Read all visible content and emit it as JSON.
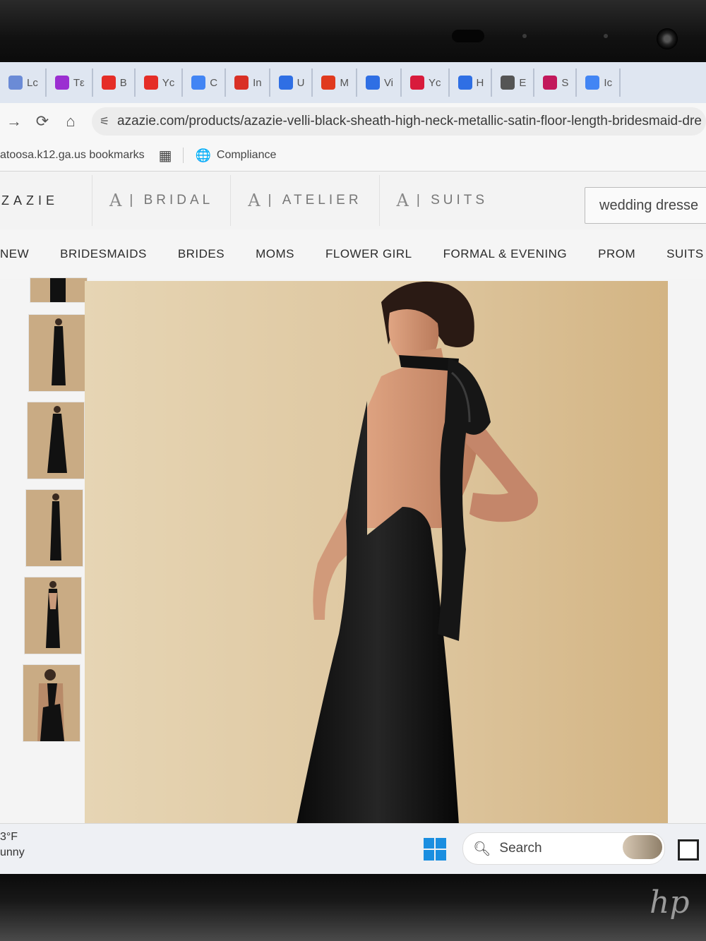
{
  "browser": {
    "tabs": [
      {
        "label": "Lc",
        "icon": "page-icon",
        "color": "#6b8bd6"
      },
      {
        "label": "Tε",
        "icon": "app-icon",
        "color": "#9b2fd1"
      },
      {
        "label": "B",
        "icon": "youtube-icon",
        "color": "#e52d27"
      },
      {
        "label": "Yc",
        "icon": "youtube-icon",
        "color": "#e52d27"
      },
      {
        "label": "C",
        "icon": "calendar-icon",
        "color": "#4285f4"
      },
      {
        "label": "In",
        "icon": "gmail-icon",
        "color": "#d93025"
      },
      {
        "label": "U",
        "icon": "docs-icon",
        "color": "#2f6fe4"
      },
      {
        "label": "M",
        "icon": "app-icon",
        "color": "#e03a1e"
      },
      {
        "label": "Vi",
        "icon": "docs-icon",
        "color": "#2f6fe4"
      },
      {
        "label": "Yc",
        "icon": "app-icon",
        "color": "#d81b3c"
      },
      {
        "label": "H",
        "icon": "docs-icon",
        "color": "#2f6fe4"
      },
      {
        "label": "E",
        "icon": "openai-icon",
        "color": "#555555"
      },
      {
        "label": "S",
        "icon": "heart-icon",
        "color": "#c2185b"
      },
      {
        "label": "Ic",
        "icon": "google-icon",
        "color": "#4285f4"
      }
    ],
    "url": "azazie.com/products/azazie-velli-black-sheath-high-neck-metallic-satin-floor-length-bridesmaid-dre",
    "bookmarks": [
      {
        "label": "atoosa.k12.ga.us bookmarks"
      },
      {
        "label": "Compliance"
      }
    ]
  },
  "site": {
    "brand": "ZAZIE",
    "subbrands": [
      "BRIDAL",
      "ATELIER",
      "SUITS"
    ],
    "search_value": "wedding dresse",
    "categories": [
      "NEW",
      "BRIDESMAIDS",
      "BRIDES",
      "MOMS",
      "FLOWER GIRL",
      "FORMAL & EVENING",
      "PROM",
      "SUITS & T"
    ],
    "dress_color": "#111111",
    "background_color": "#dcc39a"
  },
  "taskbar": {
    "temperature": "3°F",
    "condition": "unny",
    "search_label": "Search"
  }
}
